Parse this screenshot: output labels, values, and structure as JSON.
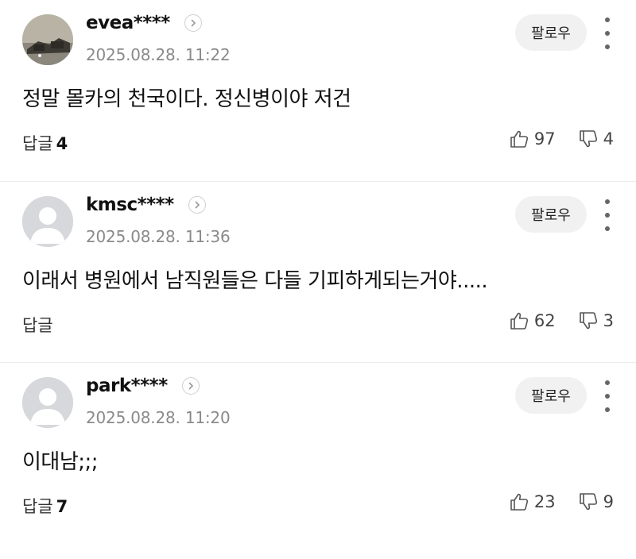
{
  "comments": [
    {
      "author": "evea****",
      "date": "2025.08.28. 11:22",
      "text": "정말 몰카의 천국이다. 정신병이야 저건",
      "reply_label": "답글",
      "reply_count": "4",
      "likes": "97",
      "dislikes": "4",
      "follow_label": "팔로우",
      "avatar": "photo"
    },
    {
      "author": "kmsc****",
      "date": "2025.08.28. 11:36",
      "text": "이래서 병원에서 남직원들은 다들 기피하게되는거야.....",
      "reply_label": "답글",
      "reply_count": "",
      "likes": "62",
      "dislikes": "3",
      "follow_label": "팔로우",
      "avatar": "default"
    },
    {
      "author": "park****",
      "date": "2025.08.28. 11:20",
      "text": "이대남;;;",
      "reply_label": "답글",
      "reply_count": "7",
      "likes": "23",
      "dislikes": "9",
      "follow_label": "팔로우",
      "avatar": "default"
    }
  ],
  "icons": {
    "like": "thumbs-up-icon",
    "dislike": "thumbs-down-icon",
    "more": "more-vertical-icon",
    "chevron": "chevron-right-icon"
  },
  "colors": {
    "text": "#111111",
    "meta": "#8a8a8a",
    "follow_bg": "#f1f1f1",
    "avatar_default": "#d6d8dc"
  }
}
